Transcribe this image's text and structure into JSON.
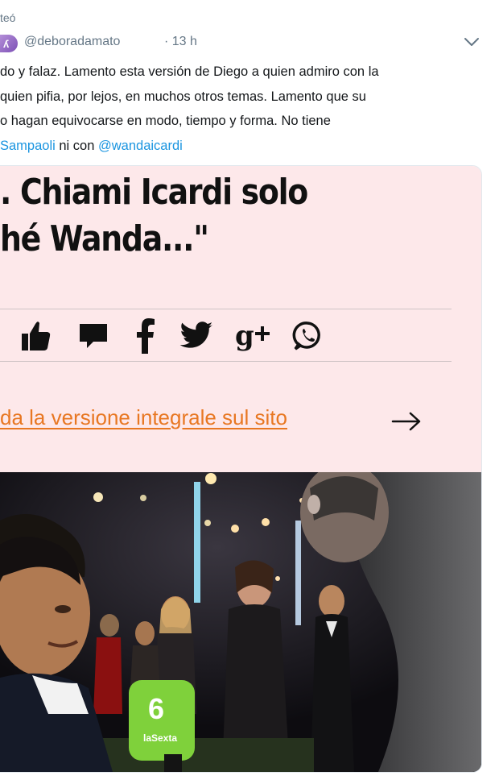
{
  "retweet": {
    "text": "teó"
  },
  "tweet": {
    "handle": "@deboradamato",
    "separator": "·",
    "time": "13 h",
    "lines": [
      {
        "text": "do y falaz. Lamento esta versión de Diego a quien admiro con la"
      },
      {
        "text": "quien pifia, por lejos, en muchos otros temas. Lamento que su"
      },
      {
        "text": "o hagan equivocarse en modo, tiempo y forma. No tiene"
      }
    ],
    "last_line": {
      "mention1": "Sampaoli",
      "middle": " ni con ",
      "mention2": "@wandaicardi"
    }
  },
  "card": {
    "headline_1": ". Chiami Icardi solo",
    "headline_2": "hé Wanda...\"",
    "cta": "da la versione integrale sul sito",
    "share_icons": [
      "thumbs-up-icon",
      "comment-icon",
      "facebook-icon",
      "twitter-icon",
      "google-plus-icon",
      "whatsapp-icon"
    ],
    "photo": {
      "mic_logo_number": "6",
      "mic_logo_text": "laSexta"
    }
  },
  "colors": {
    "link": "#1b95e0",
    "card_bg": "#fde8ea",
    "cta": "#e87722",
    "muted": "#657786"
  }
}
